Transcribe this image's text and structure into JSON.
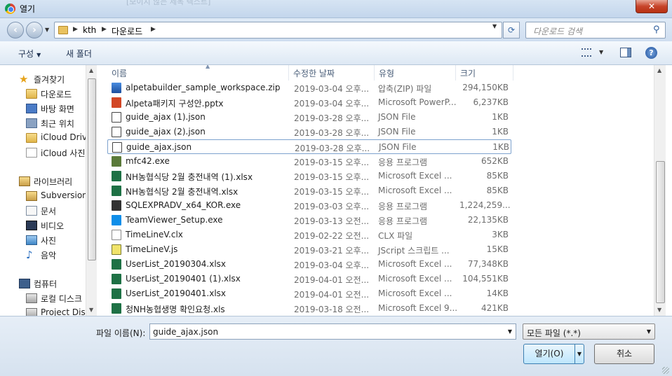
{
  "window": {
    "title": "열기",
    "ghost_title": "[보이지 않는 제목 텍스트]",
    "close_glyph": "✕"
  },
  "address": {
    "crumbs": [
      "kth",
      "다운로드"
    ],
    "search_placeholder": "다운로드 검색"
  },
  "toolbar": {
    "organize": "구성",
    "new_folder": "새 폴더"
  },
  "nav": [
    {
      "label": "즐겨찾기",
      "icon": "star-icon"
    },
    {
      "label": "다운로드",
      "icon": "downloads-folder-icon"
    },
    {
      "label": "바탕 화면",
      "icon": "desktop-icon"
    },
    {
      "label": "최근 위치",
      "icon": "recent-places-icon"
    },
    {
      "label": "iCloud Drive",
      "icon": "folder-icon"
    },
    {
      "label": "iCloud 사진",
      "icon": "document-icon"
    },
    {
      "label": "라이브러리",
      "icon": "library-icon"
    },
    {
      "label": "Subversion",
      "icon": "library-icon"
    },
    {
      "label": "문서",
      "icon": "documents-icon"
    },
    {
      "label": "비디오",
      "icon": "video-icon"
    },
    {
      "label": "사진",
      "icon": "pictures-icon"
    },
    {
      "label": "음악",
      "icon": "music-icon"
    },
    {
      "label": "컴퓨터",
      "icon": "computer-icon"
    },
    {
      "label": "로컬 디스크",
      "icon": "drive-icon"
    },
    {
      "label": "Project Disk",
      "icon": "drive-icon"
    }
  ],
  "columns": {
    "name": "이름",
    "date": "수정한 날짜",
    "type": "유형",
    "size": "크기"
  },
  "files": [
    {
      "name": "alpetabuilder_sample_workspace.zip",
      "date": "2019-03-04 오후...",
      "type": "압축(ZIP) 파일",
      "size": "294,150KB",
      "icon": "zip-icon"
    },
    {
      "name": "Alpeta패키지 구성안.pptx",
      "date": "2019-03-04 오후...",
      "type": "Microsoft PowerP...",
      "size": "6,237KB",
      "icon": "powerpoint-icon"
    },
    {
      "name": "guide_ajax (1).json",
      "date": "2019-03-28 오후...",
      "type": "JSON File",
      "size": "1KB",
      "icon": "json-icon"
    },
    {
      "name": "guide_ajax (2).json",
      "date": "2019-03-28 오후...",
      "type": "JSON File",
      "size": "1KB",
      "icon": "json-icon"
    },
    {
      "name": "guide_ajax.json",
      "date": "2019-03-28 오후...",
      "type": "JSON File",
      "size": "1KB",
      "icon": "json-icon"
    },
    {
      "name": "mfc42.exe",
      "date": "2019-03-15 오후...",
      "type": "응용 프로그램",
      "size": "652KB",
      "icon": "exe-icon"
    },
    {
      "name": "NH농협식당 2월 충전내역 (1).xlsx",
      "date": "2019-03-15 오후...",
      "type": "Microsoft Excel ...",
      "size": "85KB",
      "icon": "excel-icon"
    },
    {
      "name": "NH농협식당 2월 충전내역.xlsx",
      "date": "2019-03-15 오후...",
      "type": "Microsoft Excel ...",
      "size": "85KB",
      "icon": "excel-icon"
    },
    {
      "name": "SQLEXPRADV_x64_KOR.exe",
      "date": "2019-03-03 오후...",
      "type": "응용 프로그램",
      "size": "1,224,259...",
      "icon": "sql-installer-icon"
    },
    {
      "name": "TeamViewer_Setup.exe",
      "date": "2019-03-13 오전...",
      "type": "응용 프로그램",
      "size": "22,135KB",
      "icon": "teamviewer-icon"
    },
    {
      "name": "TimeLineV.clx",
      "date": "2019-02-22 오전...",
      "type": "CLX 파일",
      "size": "3KB",
      "icon": "file-icon"
    },
    {
      "name": "TimeLineV.js",
      "date": "2019-03-21 오후...",
      "type": "JScript 스크립트 ...",
      "size": "15KB",
      "icon": "script-icon"
    },
    {
      "name": "UserList_20190304.xlsx",
      "date": "2019-03-04 오후...",
      "type": "Microsoft Excel ...",
      "size": "77,348KB",
      "icon": "excel-icon"
    },
    {
      "name": "UserList_20190401 (1).xlsx",
      "date": "2019-04-01 오전...",
      "type": "Microsoft Excel ...",
      "size": "104,551KB",
      "icon": "excel-icon"
    },
    {
      "name": "UserList_20190401.xlsx",
      "date": "2019-04-01 오전...",
      "type": "Microsoft Excel ...",
      "size": "14KB",
      "icon": "excel-icon"
    },
    {
      "name": "청NH농협생명 확인요청.xls",
      "date": "2019-03-18 오전...",
      "type": "Microsoft Excel 9...",
      "size": "421KB",
      "icon": "excel-icon"
    }
  ],
  "footer": {
    "filename_label": "파일 이름(N):",
    "filename_value": "guide_ajax.json",
    "filetype_value": "모든 파일 (*.*)",
    "open_label": "열기(O)",
    "cancel_label": "취소"
  }
}
